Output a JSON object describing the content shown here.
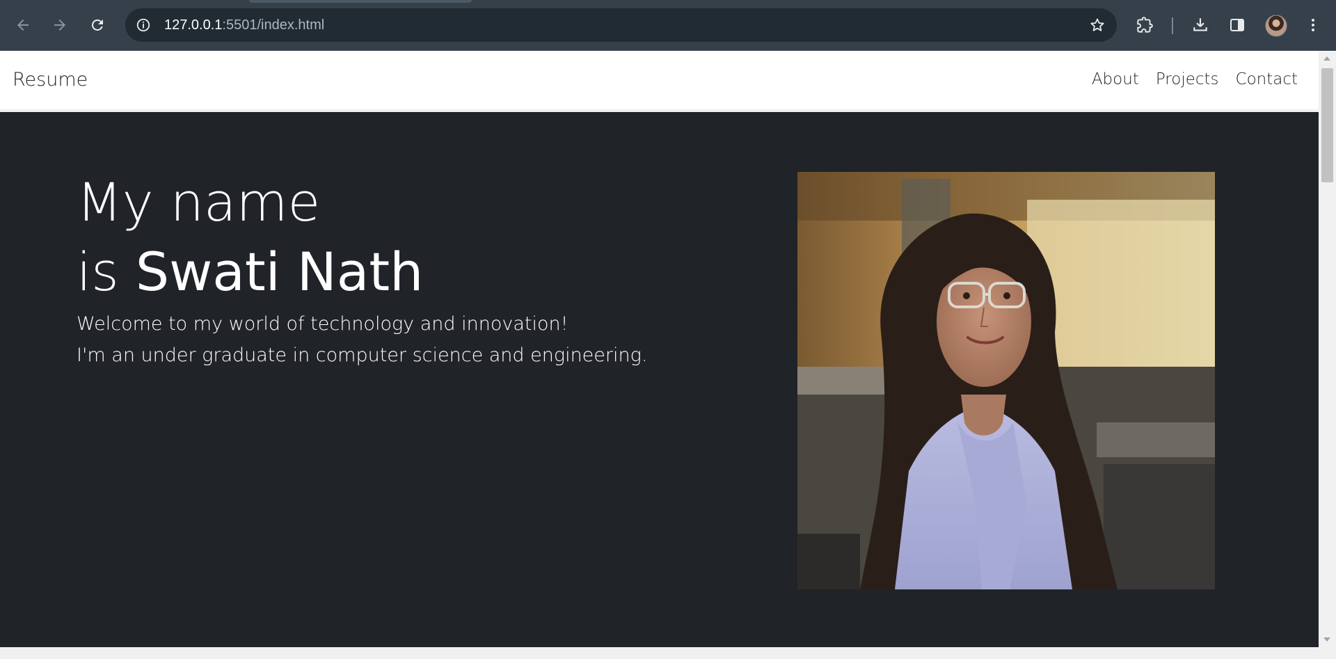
{
  "browser": {
    "url_host": "127.0.0.1",
    "url_path": ":5501/index.html",
    "icons": [
      "back-arrow-icon",
      "forward-arrow-icon",
      "reload-icon",
      "site-info-icon",
      "bookmark-star-icon",
      "extensions-icon",
      "download-icon",
      "side-panel-icon",
      "profile-avatar",
      "more-menu-icon"
    ]
  },
  "navbar": {
    "brand": "Resume",
    "links": [
      "About",
      "Projects",
      "Contact"
    ]
  },
  "hero": {
    "line1": "My name",
    "line2_prefix": "is ",
    "name": "Swati Nath",
    "tagline_1": "Welcome to my world of technology and innovation!",
    "tagline_2": "I'm an under graduate in computer science and engineering."
  },
  "colors": {
    "chrome_bg": "#35404a",
    "omnibox_bg": "#212b33",
    "hero_bg": "#202328",
    "navbar_bg": "#ffffff",
    "text_light": "#ffffff",
    "text_dark": "#212529"
  }
}
